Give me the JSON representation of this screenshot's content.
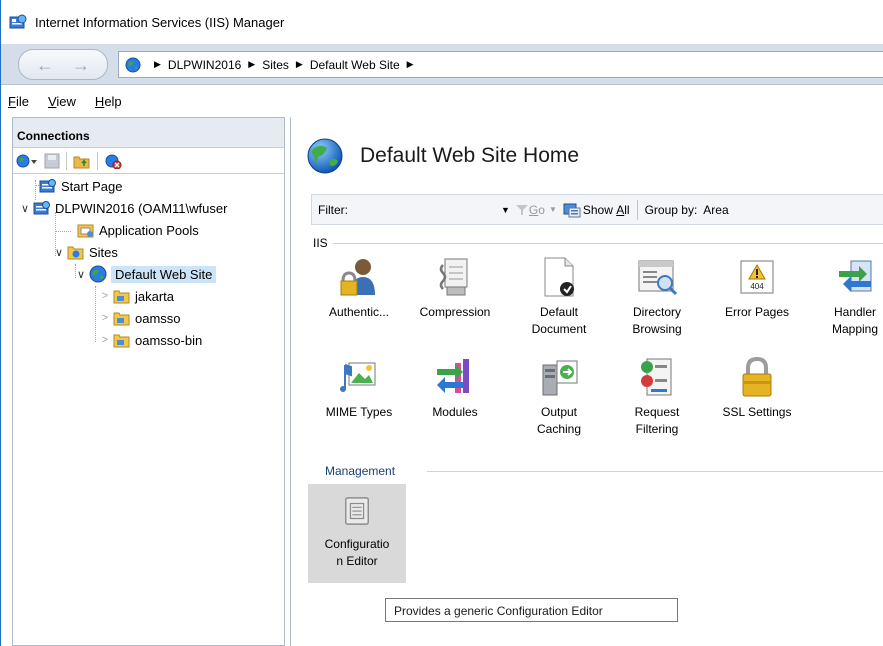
{
  "window": {
    "title": "Internet Information Services (IIS) Manager"
  },
  "address": {
    "crumbs": [
      "DLPWIN2016",
      "Sites",
      "Default Web Site"
    ]
  },
  "menu": {
    "file_prefix": "F",
    "file_rest": "ile",
    "view_prefix": "V",
    "view_rest": "iew",
    "help_prefix": "H",
    "help_rest": "elp"
  },
  "connections": {
    "header": "Connections",
    "tree": {
      "start_page": "Start Page",
      "server": "DLPWIN2016 (OAM11\\wfuser",
      "app_pools": "Application Pools",
      "sites": "Sites",
      "default_site": "Default Web Site",
      "children": [
        "jakarta",
        "oamsso",
        "oamsso-bin"
      ]
    }
  },
  "main": {
    "title": "Default Web Site Home",
    "filter": {
      "label": "Filter:",
      "go_prefix": "G",
      "go_rest": "o",
      "show_all_prefix": "Show ",
      "show_all_key": "A",
      "show_all_rest": "ll",
      "group_by_label": "Group by:",
      "group_by_value": "Area"
    },
    "sections": {
      "iis": "IIS",
      "management": "Management"
    },
    "features_row1": [
      {
        "line1": "Authentic...",
        "line2": ""
      },
      {
        "line1": "Compression",
        "line2": ""
      },
      {
        "line1": "Default",
        "line2": "Document"
      },
      {
        "line1": "Directory",
        "line2": "Browsing"
      },
      {
        "line1": "Error Pages",
        "line2": ""
      },
      {
        "line1": "Handler",
        "line2": "Mapping"
      }
    ],
    "features_row2": [
      {
        "line1": "MIME Types",
        "line2": ""
      },
      {
        "line1": "Modules",
        "line2": ""
      },
      {
        "line1": "Output",
        "line2": "Caching"
      },
      {
        "line1": "Request",
        "line2": "Filtering"
      },
      {
        "line1": "SSL Settings",
        "line2": ""
      }
    ],
    "management_items": [
      {
        "line1": "Configuratio",
        "line2": "n Editor"
      }
    ],
    "error_icon_text": "404"
  },
  "tooltip": "Provides a generic Configuration Editor",
  "colors": {
    "accent": "#1f6fc5",
    "selected": "#cce4f7",
    "hover": "#d9d9d9"
  }
}
